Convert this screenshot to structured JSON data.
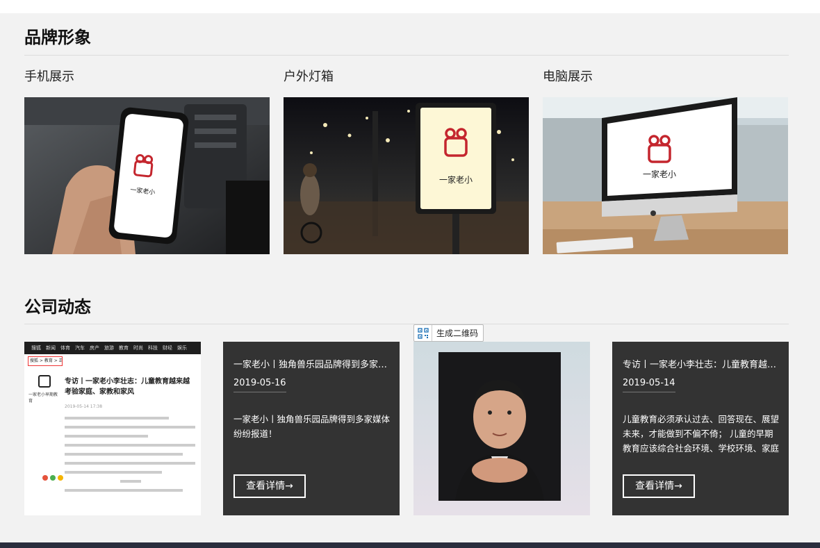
{
  "brand": {
    "title": "品牌形象",
    "items": [
      {
        "label": "手机展示",
        "logo_main": "一家老小"
      },
      {
        "label": "户外灯箱",
        "logo_main": "一家老小"
      },
      {
        "label": "电脑展示",
        "logo_main": "一家老小"
      }
    ]
  },
  "news": {
    "title": "公司动态",
    "qr_button": "生成二维码",
    "thumb1": {
      "nav": [
        "搜狐",
        "新闻",
        "体育",
        "汽车",
        "房产",
        "旅游",
        "教育",
        "时尚",
        "科技",
        "财经",
        "娱乐"
      ],
      "breadcrumb": "搜狐 > 教育 > 正文",
      "headline": "专访丨一家老小李壮志：儿童教育越来越考验家庭、家教和家风",
      "account": "一家老小早期教育",
      "date": "2019-05-14 17:38"
    },
    "cards": [
      {
        "title": "一家老小丨独角兽乐园品牌得到多家媒体纷纷报道！",
        "date": "2019-05-16",
        "desc": "一家老小丨独角兽乐园品牌得到多家媒体纷纷报道！",
        "button": "查看详情→"
      },
      {
        "title": "专访丨一家老小李壮志：儿童教育越来越考验家庭、家教和家风",
        "date": "2019-05-14",
        "desc": "儿童教育必须承认过去、回答现在、展望未来，才能做到不偏不倚； 儿童的早期教育应该综合社会环境、学校环境、家庭环境",
        "button": "查看详情→"
      }
    ]
  },
  "colors": {
    "logo_red": "#c4262e",
    "dark_card": "#333333",
    "footer": "#2a2d3d"
  }
}
